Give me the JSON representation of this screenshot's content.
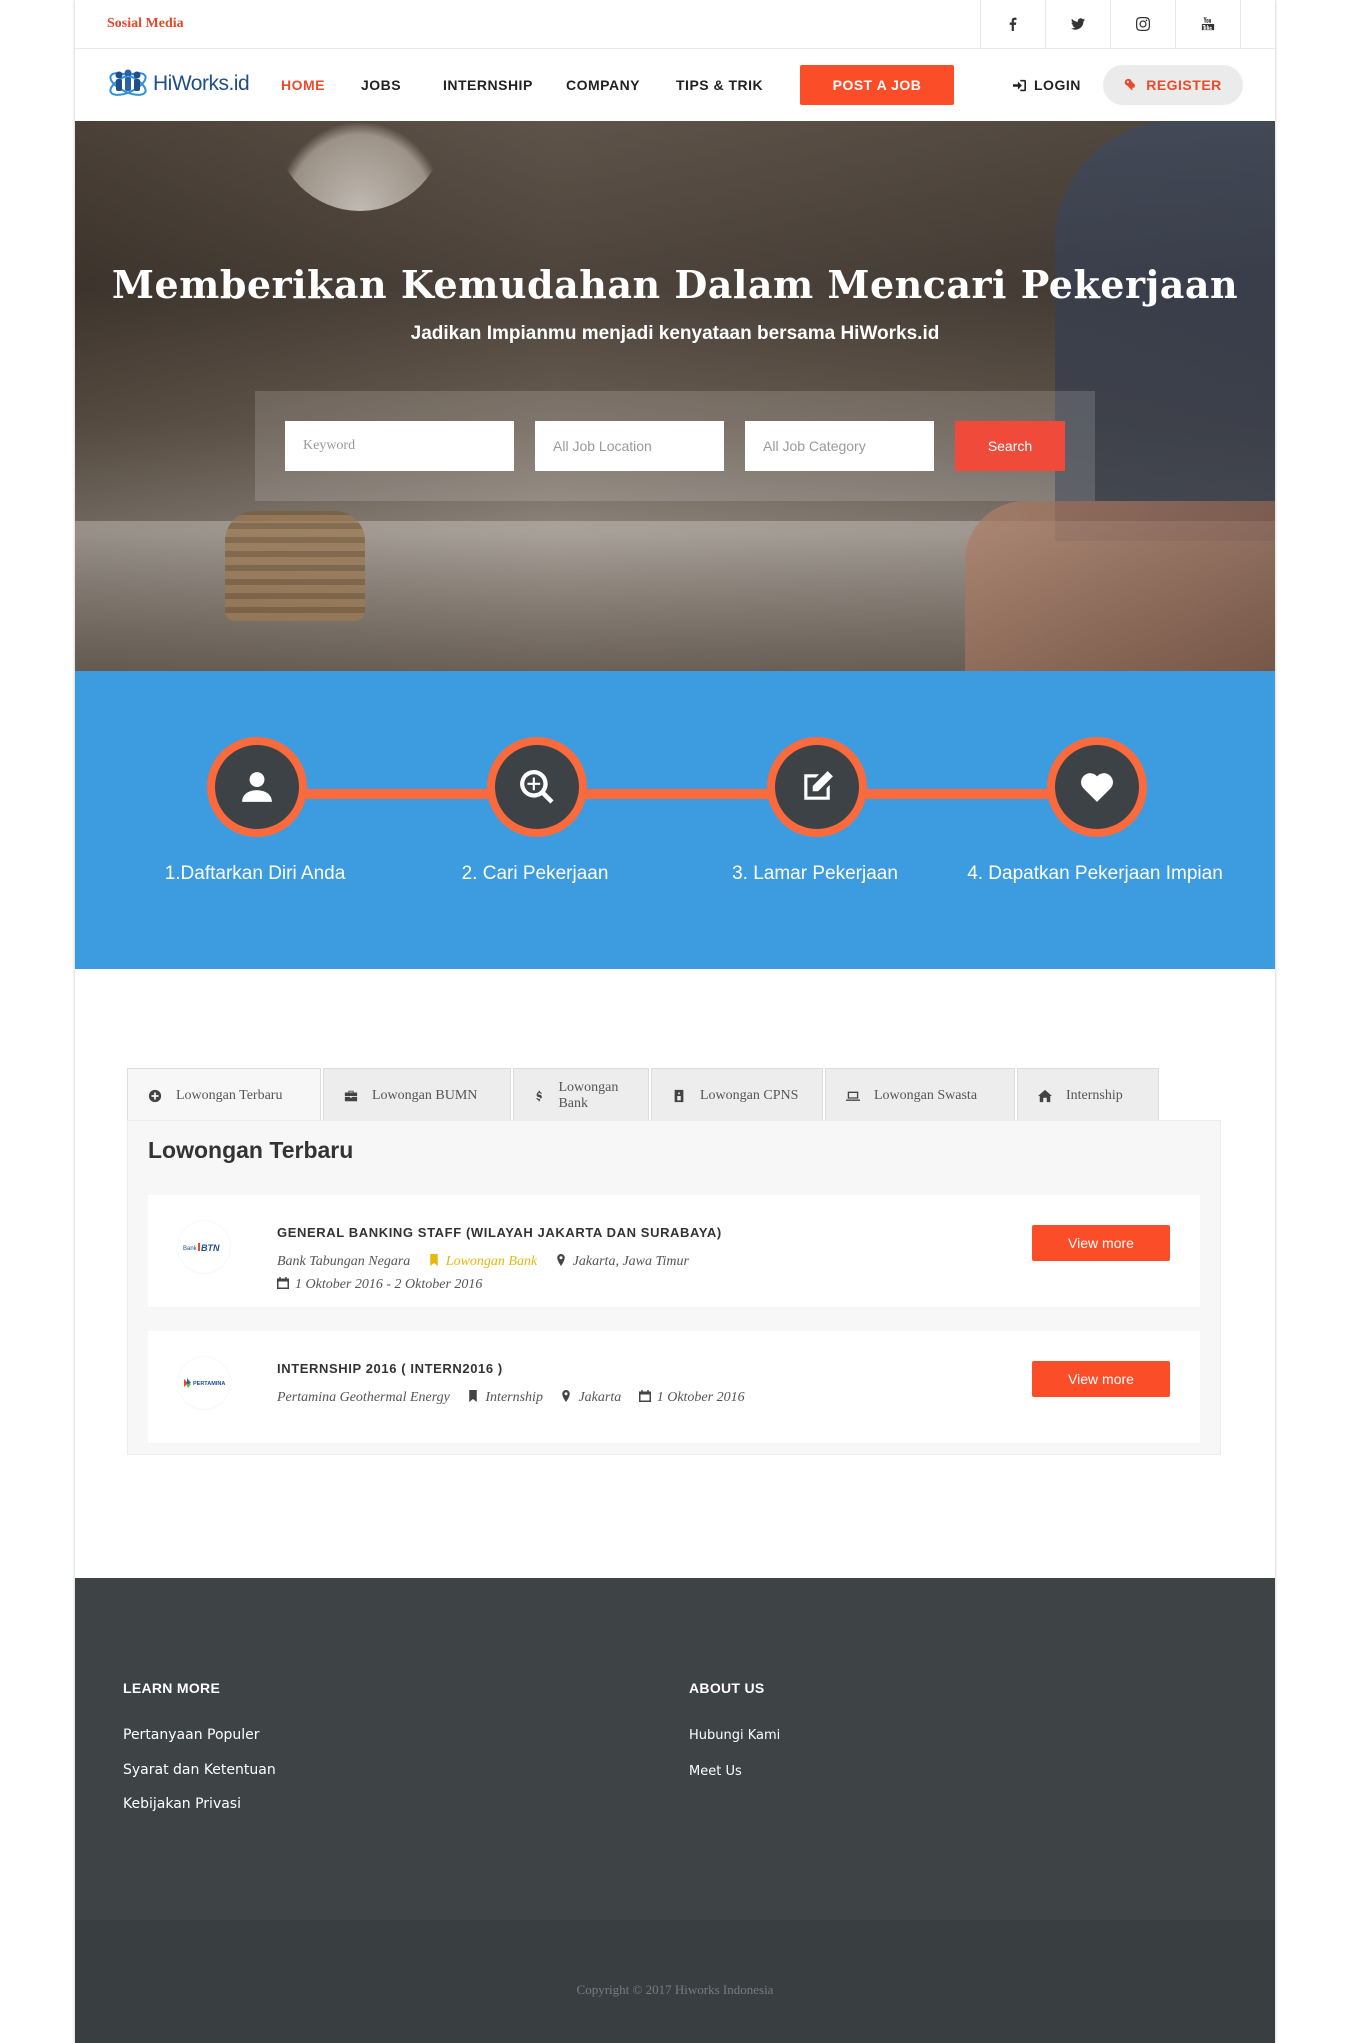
{
  "topbar": {
    "social_label": "Sosial Media",
    "icons": [
      "facebook-icon",
      "twitter-icon",
      "instagram-icon",
      "youtube-icon"
    ]
  },
  "nav": {
    "logo_text": "HiWorks.id",
    "items": [
      "HOME",
      "JOBS",
      "INTERNSHIP",
      "COMPANY",
      "TIPS & TRIK"
    ],
    "post_job": "POST A JOB",
    "login": "LOGIN",
    "register": "REGISTER"
  },
  "hero": {
    "title": "Memberikan Kemudahan Dalam Mencari Pekerjaan",
    "subtitle": "Jadikan Impianmu menjadi kenyataan bersama HiWorks.id",
    "keyword_placeholder": "Keyword",
    "location_placeholder": "All Job Location",
    "category_placeholder": "All Job Category",
    "search_label": "Search"
  },
  "steps": [
    {
      "label": "1.Daftarkan Diri Anda",
      "icon": "user-icon"
    },
    {
      "label": "2. Cari Pekerjaan",
      "icon": "search-plus-icon"
    },
    {
      "label": "3. Lamar Pekerjaan",
      "icon": "edit-icon"
    },
    {
      "label": "4. Dapatkan Pekerjaan Impian",
      "icon": "heart-icon"
    }
  ],
  "tabs": [
    {
      "label": "Lowongan Terbaru",
      "icon": "plus-circle-icon"
    },
    {
      "label": "Lowongan BUMN",
      "icon": "briefcase-icon"
    },
    {
      "label": "Lowongan Bank",
      "icon": "dollar-icon"
    },
    {
      "label": "Lowongan CPNS",
      "icon": "id-card-icon"
    },
    {
      "label": "Lowongan Swasta",
      "icon": "laptop-icon"
    },
    {
      "label": "Internship",
      "icon": "home-icon"
    }
  ],
  "panel": {
    "title": "Lowongan Terbaru",
    "jobs": [
      {
        "title": "GENERAL BANKING STAFF (WILAYAH JAKARTA DAN SURABAYA)",
        "company": "Bank Tabungan Negara",
        "category": "Lowongan Bank",
        "location": "Jakarta, Jawa Timur",
        "date": "1 Oktober 2016 - 2 Oktober 2016",
        "logo_text": "Bank BTN",
        "button": "View more"
      },
      {
        "title": "INTERNSHIP 2016 ( INTERN2016 )",
        "company": "Pertamina Geothermal Energy",
        "category": "Internship",
        "location": "Jakarta",
        "date": "1 Oktober 2016",
        "logo_text": "PERTAMINA",
        "button": "View more"
      }
    ]
  },
  "footer": {
    "learn_more": {
      "heading": "LEARN MORE",
      "links": [
        "Pertanyaan Populer",
        "Syarat dan Ketentuan",
        "Kebijakan Privasi"
      ]
    },
    "about_us": {
      "heading": "ABOUT US",
      "links": [
        "Hubungi Kami",
        "Meet Us"
      ]
    },
    "copyright": "Copyright © 2017 Hiworks Indonesia"
  },
  "colors": {
    "accent": "#fb4e28",
    "steps_bg": "#3d9ce0",
    "footer_bg": "#3e4346",
    "bank_highlight": "#e8b80e"
  }
}
